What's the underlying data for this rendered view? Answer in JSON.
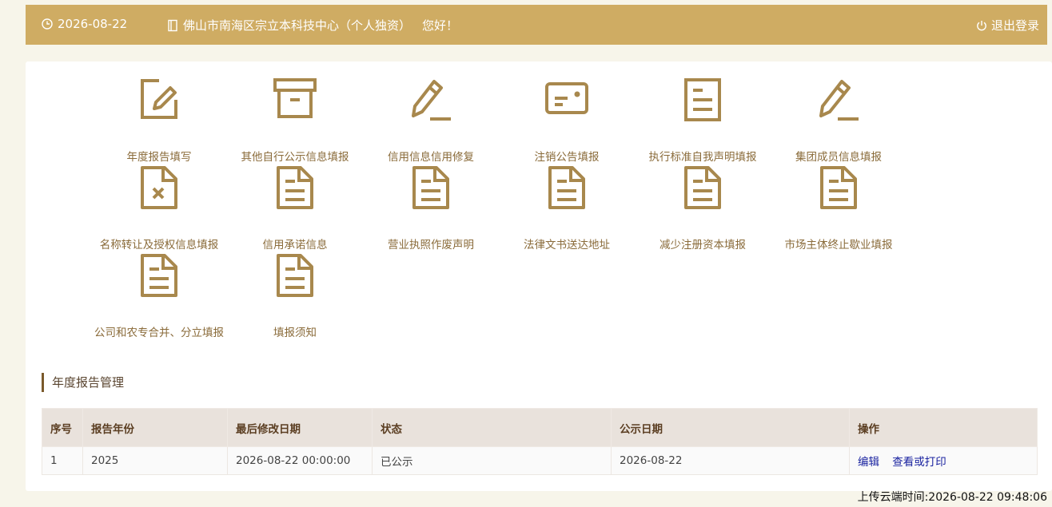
{
  "header": {
    "date": "2026-08-22",
    "company": "佛山市南海区宗立本科技中心（个人独资）",
    "greeting": "您好！",
    "logout": "退出登录"
  },
  "tiles": [
    {
      "label": "年度报告填写",
      "icon": "edit-icon"
    },
    {
      "label": "其他自行公示信息填报",
      "icon": "archive-box-icon"
    },
    {
      "label": "信用信息信用修复",
      "icon": "pencil-icon"
    },
    {
      "label": "注销公告填报",
      "icon": "id-card-icon"
    },
    {
      "label": "执行标准自我声明填报",
      "icon": "document-icon"
    },
    {
      "label": "集团成员信息填报",
      "icon": "pencil-icon"
    },
    {
      "label": "名称转让及授权信息填报",
      "icon": "document-x-icon"
    },
    {
      "label": "信用承诺信息",
      "icon": "document-lines-icon"
    },
    {
      "label": "营业执照作废声明",
      "icon": "document-lines-icon"
    },
    {
      "label": "法律文书送达地址",
      "icon": "document-lines-icon"
    },
    {
      "label": "减少注册资本填报",
      "icon": "document-lines-icon"
    },
    {
      "label": "市场主体终止歇业填报",
      "icon": "document-lines-icon"
    },
    {
      "label": "公司和农专合并、分立填报",
      "icon": "document-lines-icon"
    },
    {
      "label": "填报须知",
      "icon": "document-lines-icon"
    }
  ],
  "section": {
    "title": "年度报告管理"
  },
  "table": {
    "headers": [
      "序号",
      "报告年份",
      "最后修改日期",
      "状态",
      "公示日期",
      "操作"
    ],
    "rows": [
      {
        "no": "1",
        "year": "2025",
        "modified": "2026-08-22 00:00:00",
        "status": "已公示",
        "published": "2026-08-22",
        "actions": [
          "编辑",
          "查看或打印"
        ]
      }
    ]
  },
  "footer": {
    "upload_time": "上传云端时间:2026-08-22 09:48:06"
  },
  "colors": {
    "brand": "#cfac63",
    "icon": "#a8884d",
    "label": "#8a6b3a",
    "link": "#1a23a0"
  }
}
